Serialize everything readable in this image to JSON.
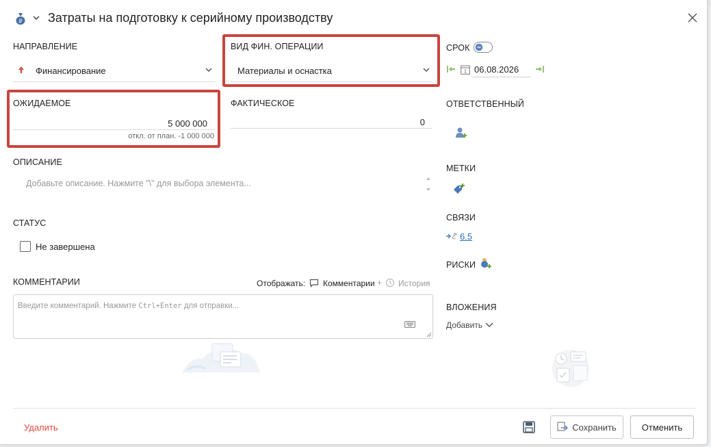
{
  "header": {
    "title": "Затраты на подготовку к серийному производству",
    "icon": "money-bag-icon"
  },
  "direction": {
    "label": "НАПРАВЛЕНИЕ",
    "value": "Финансирование"
  },
  "fin_operation": {
    "label": "ВИД ФИН. ОПЕРАЦИИ",
    "value": "Материалы и оснастка"
  },
  "expected": {
    "label": "ОЖИДАЕМОЕ",
    "value": "5 000 000",
    "deviation": "откл. от план. -1 000 000"
  },
  "actual": {
    "label": "ФАКТИЧЕСКОЕ",
    "value": "0"
  },
  "description": {
    "label": "ОПИСАНИЕ",
    "placeholder": "Добавьте описание. Нажмите \"\\\" для выбора элемента..."
  },
  "status": {
    "label": "СТАТУС",
    "checkbox_label": "Не завершена"
  },
  "comments": {
    "label": "КОММЕНТАРИИ",
    "show_label": "Отображать:",
    "comments_option": "Комментарии",
    "plus": "+",
    "history_option": "История",
    "placeholder_main": "Введите комментарий. Нажмите",
    "placeholder_keys": "Ctrl+Enter",
    "placeholder_end": "для отправки..."
  },
  "deadline": {
    "label": "СРОК",
    "date": "06.08.2026"
  },
  "responsible": {
    "label": "ОТВЕТСТВЕННЫЙ"
  },
  "tags": {
    "label": "МЕТКИ"
  },
  "links": {
    "label": "СВЯЗИ",
    "item": "6.5"
  },
  "risks": {
    "label": "РИСКИ"
  },
  "attachments": {
    "label": "ВЛОЖЕНИЯ",
    "add_label": "Добавить"
  },
  "footer": {
    "delete_label": "Удалить",
    "save_label": "Сохранить",
    "cancel_label": "Отменить"
  },
  "colors": {
    "accent": "#2a6fb6",
    "danger": "#e0463d",
    "highlight": "#c9453e",
    "add_green": "#6aa83a"
  }
}
